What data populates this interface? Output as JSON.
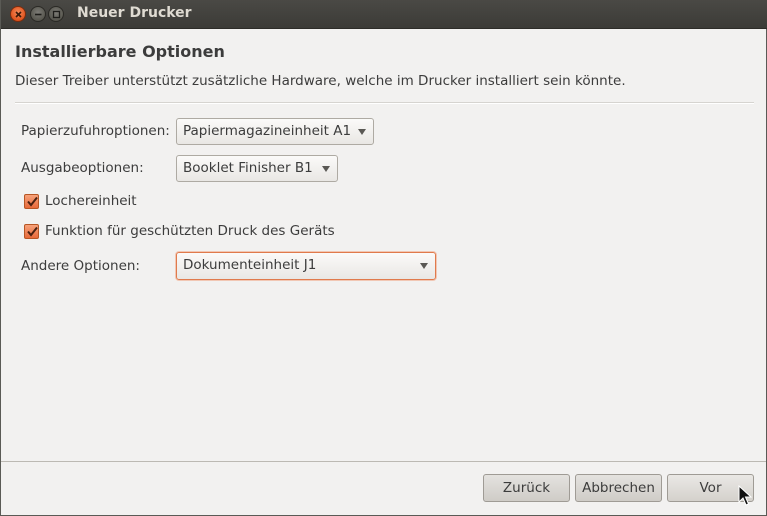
{
  "window": {
    "title": "Neuer Drucker"
  },
  "page": {
    "heading": "Installierbare Optionen",
    "description": "Dieser Treiber unterstützt zusätzliche Hardware, welche im Drucker installiert sein könnte."
  },
  "options": {
    "paper_feed": {
      "label": "Papierzufuhroptionen:",
      "value": "Papiermagazineinheit A1"
    },
    "output": {
      "label": "Ausgabeoptionen:",
      "value": "Booklet Finisher B1"
    },
    "puncher": {
      "label": "Lochereinheit",
      "checked": true
    },
    "secure_print": {
      "label": "Funktion für geschützten Druck des Geräts",
      "checked": true
    },
    "other": {
      "label": "Andere Optionen:",
      "value": "Dokumenteinheit J1"
    }
  },
  "buttons": {
    "back": "Zurück",
    "cancel": "Abbrechen",
    "forward": "Vor"
  },
  "colors": {
    "accent": "#e7693a",
    "titlebar": "#3c3b37",
    "background": "#f2f1f0"
  }
}
